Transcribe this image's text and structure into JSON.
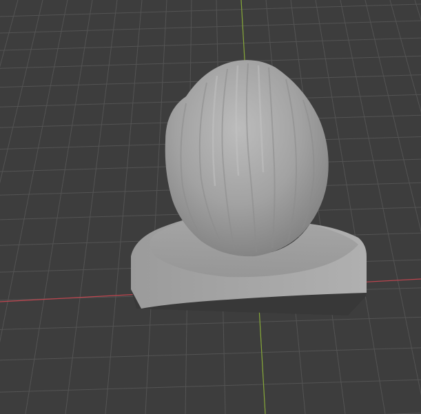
{
  "viewport": {
    "background": "#3d3d3d",
    "grid_color": "#545454",
    "x_axis_color": "#c0454f",
    "y_axis_color": "#86a838",
    "subject": "3d-bust-model",
    "model_color": "#9a9a9a",
    "base_side_color": "#3b3b3b"
  }
}
